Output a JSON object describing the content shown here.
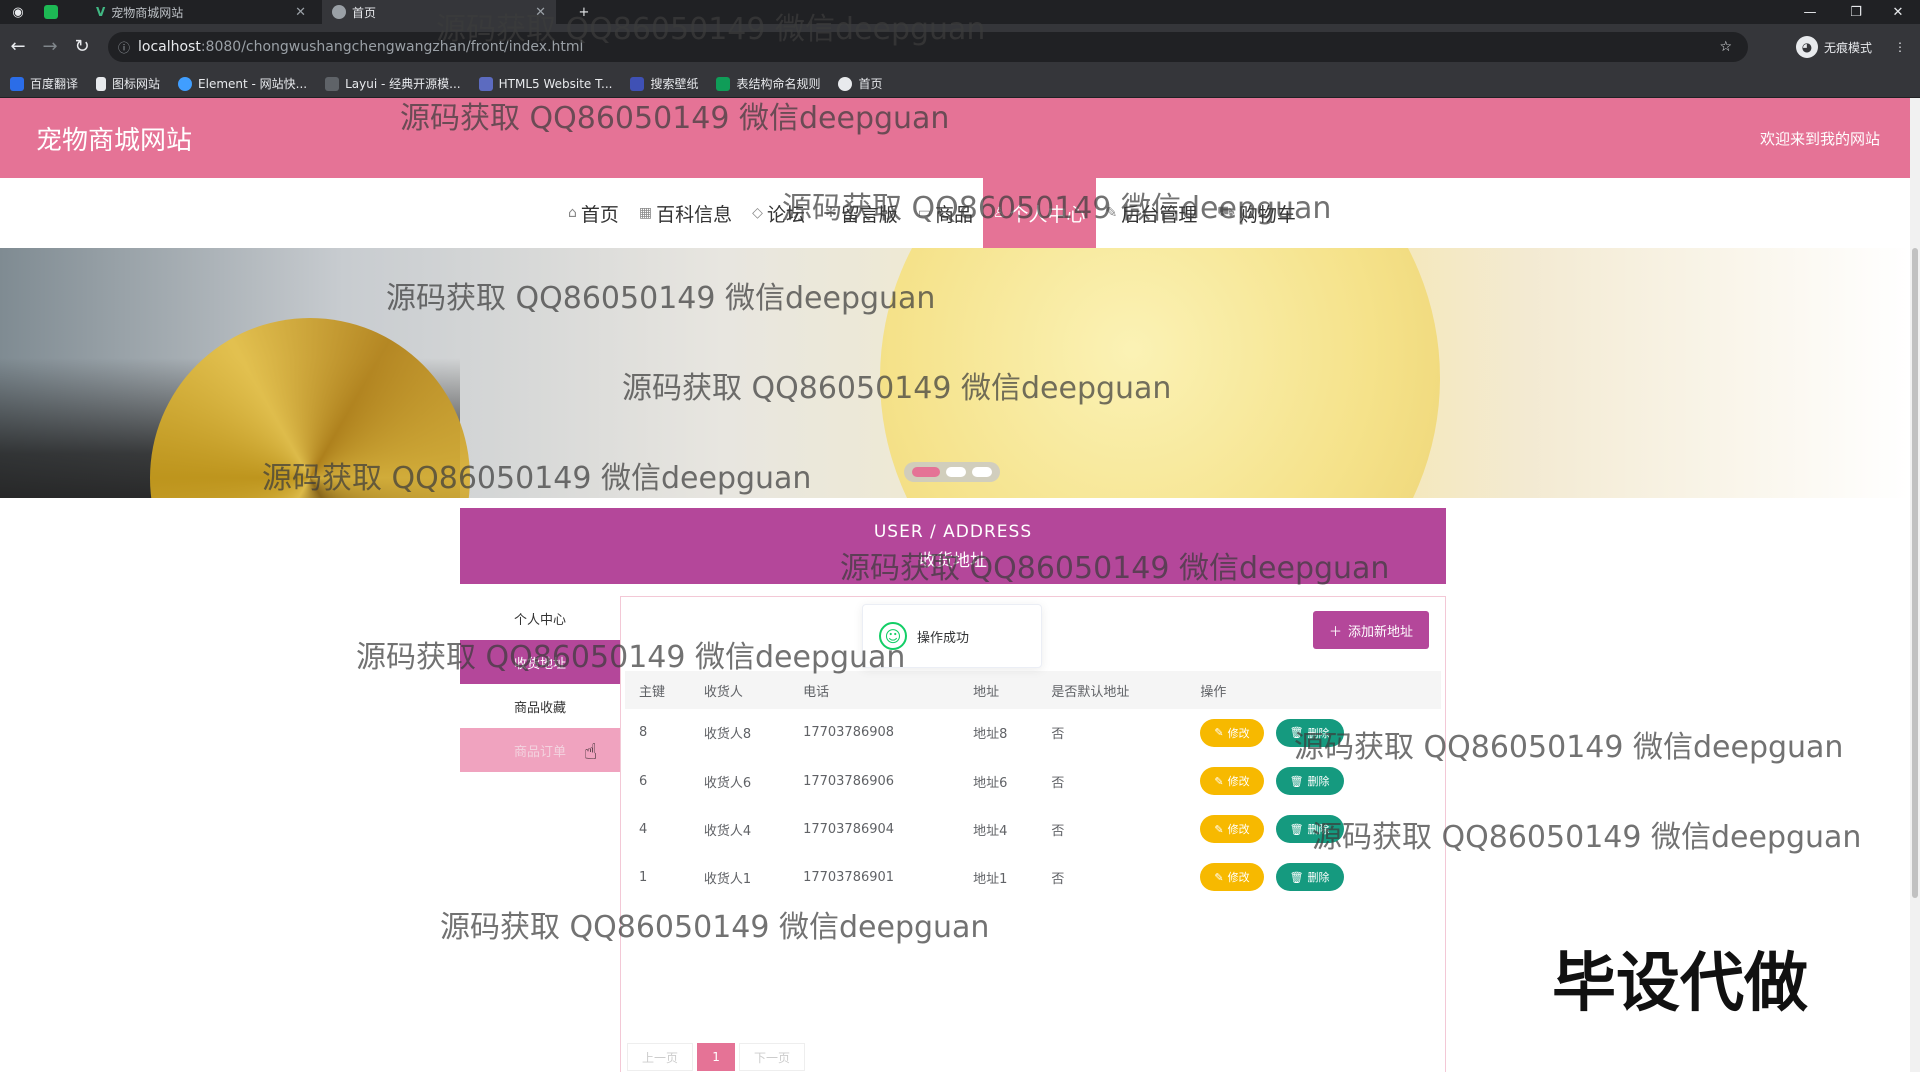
{
  "browser": {
    "tabs": [
      {
        "title": "宠物商城网站",
        "active": false
      },
      {
        "title": "首页",
        "active": true
      }
    ],
    "url_host": "localhost",
    "url_path": ":8080/chongwushangchengwangzhan/front/index.html",
    "incognito_label": "无痕模式",
    "bookmarks": [
      "百度翻译",
      "图标网站",
      "Element - 网站快...",
      "Layui - 经典开源模...",
      "HTML5 Website T...",
      "搜索壁纸",
      "表结构命名规则",
      "首页"
    ]
  },
  "header": {
    "site_title": "宠物商城网站",
    "welcome": "欢迎来到我的网站"
  },
  "nav": {
    "items": [
      {
        "label": "首页",
        "icon": "home-icon"
      },
      {
        "label": "百科信息",
        "icon": "grid-icon"
      },
      {
        "label": "论坛",
        "icon": "tag-icon"
      },
      {
        "label": "留言版",
        "icon": "gear-icon"
      },
      {
        "label": "商品",
        "icon": "goods-icon"
      },
      {
        "label": "个人中心",
        "icon": "user-icon"
      },
      {
        "label": "后台管理",
        "icon": "wrench-icon"
      },
      {
        "label": "购物车",
        "icon": "cart-icon"
      }
    ],
    "active_index": 5
  },
  "section": {
    "title_en": "USER / ADDRESS",
    "title_cn": "收货地址"
  },
  "sidebar": {
    "items": [
      "个人中心",
      "收货地址",
      "商品收藏",
      "商品订单"
    ]
  },
  "toast": {
    "message": "操作成功"
  },
  "actions": {
    "add_address": "添加新地址",
    "edit": "修改",
    "delete": "删除"
  },
  "table": {
    "columns": [
      "主键",
      "收货人",
      "电话",
      "地址",
      "是否默认地址",
      "操作"
    ],
    "rows": [
      {
        "id": "8",
        "name": "收货人8",
        "phone": "17703786908",
        "address": "地址8",
        "default": "否"
      },
      {
        "id": "6",
        "name": "收货人6",
        "phone": "17703786906",
        "address": "地址6",
        "default": "否"
      },
      {
        "id": "4",
        "name": "收货人4",
        "phone": "17703786904",
        "address": "地址4",
        "default": "否"
      },
      {
        "id": "1",
        "name": "收货人1",
        "phone": "17703786901",
        "address": "地址1",
        "default": "否"
      }
    ]
  },
  "pagination": {
    "prev": "上一页",
    "current": "1",
    "next": "下一页"
  },
  "watermark_text": "源码获取 QQ86050149 微信deepguan",
  "stamp_text": "毕设代做",
  "colors": {
    "brand_pink": "#e57396",
    "brand_purple": "#b4479a",
    "edit_yellow": "#f7b900",
    "delete_teal": "#159a7f"
  }
}
